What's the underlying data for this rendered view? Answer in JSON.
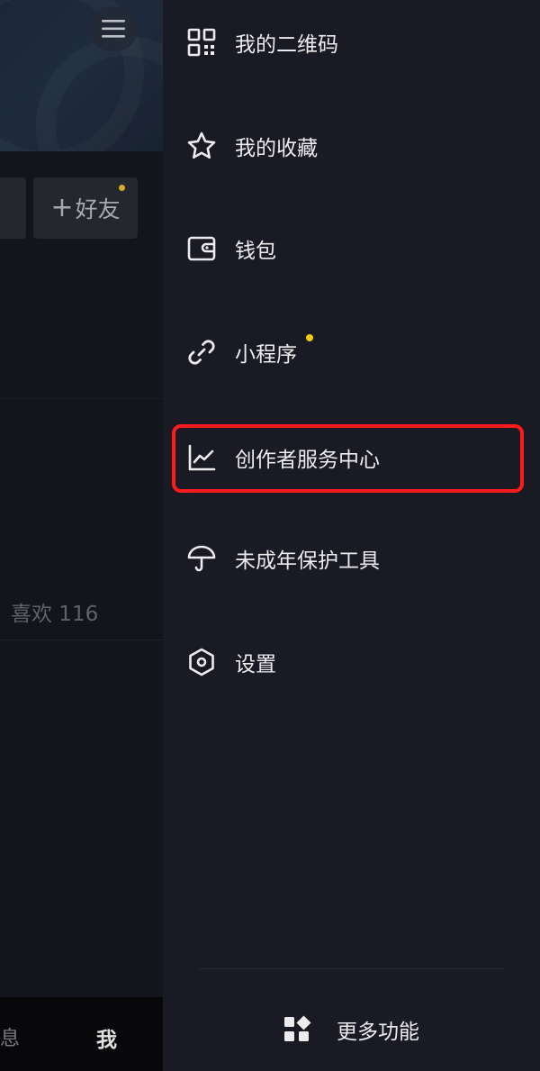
{
  "profile": {
    "add_friend_label": "好友",
    "add_friend_prefix": "+",
    "likes_tab_label": "喜欢 116"
  },
  "bottom_nav": {
    "messages_label": "息",
    "me_label": "我"
  },
  "drawer": {
    "items": [
      {
        "label": "我的二维码",
        "icon": "qr-code-icon"
      },
      {
        "label": "我的收藏",
        "icon": "star-icon"
      },
      {
        "label": "钱包",
        "icon": "wallet-icon"
      },
      {
        "label": "小程序",
        "icon": "link-icon"
      },
      {
        "label": "创作者服务中心",
        "icon": "chart-line-icon"
      },
      {
        "label": "未成年保护工具",
        "icon": "umbrella-icon"
      },
      {
        "label": "设置",
        "icon": "hexagon-settings-icon"
      }
    ],
    "more_label": "更多功能",
    "more_icon": "grid-apps-icon"
  },
  "colors": {
    "drawer_bg": "#191a24",
    "highlight": "#ff1b1b",
    "dot": "#f6c90e"
  }
}
